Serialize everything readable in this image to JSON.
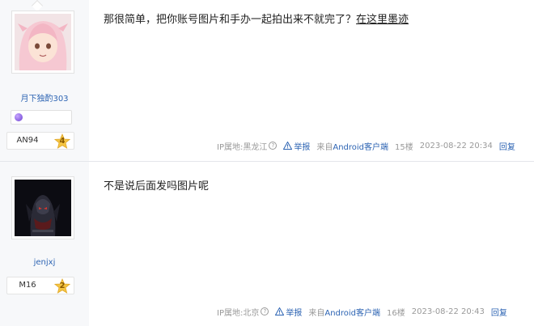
{
  "posts": [
    {
      "user": {
        "name": "月下独酌303",
        "level_name": "AN94",
        "level_num": "4"
      },
      "content_prefix": "那很简单，把你账号图片和手办一起拍出来不就完了？",
      "content_underlined": "在这里墨迹",
      "meta": {
        "ip_label": "IP属地:",
        "ip_location": "黑龙江",
        "report": "举报",
        "from_prefix": "来自",
        "from_client": "Android客户端",
        "floor": "15楼",
        "time": "2023-08-22 20:34",
        "reply": "回复"
      }
    },
    {
      "user": {
        "name": "jenjxj",
        "level_name": "M16",
        "level_num": "2"
      },
      "content_prefix": "不是说后面发吗图片呢",
      "meta": {
        "ip_label": "IP属地:",
        "ip_location": "北京",
        "report": "举报",
        "from_prefix": "来自",
        "from_client": "Android客户端",
        "floor": "16楼",
        "time": "2023-08-22 20:43",
        "reply": "回复"
      }
    }
  ],
  "icons": {
    "help": "?",
    "star_color": "#f5c542",
    "link_color": "#2d64b3"
  }
}
